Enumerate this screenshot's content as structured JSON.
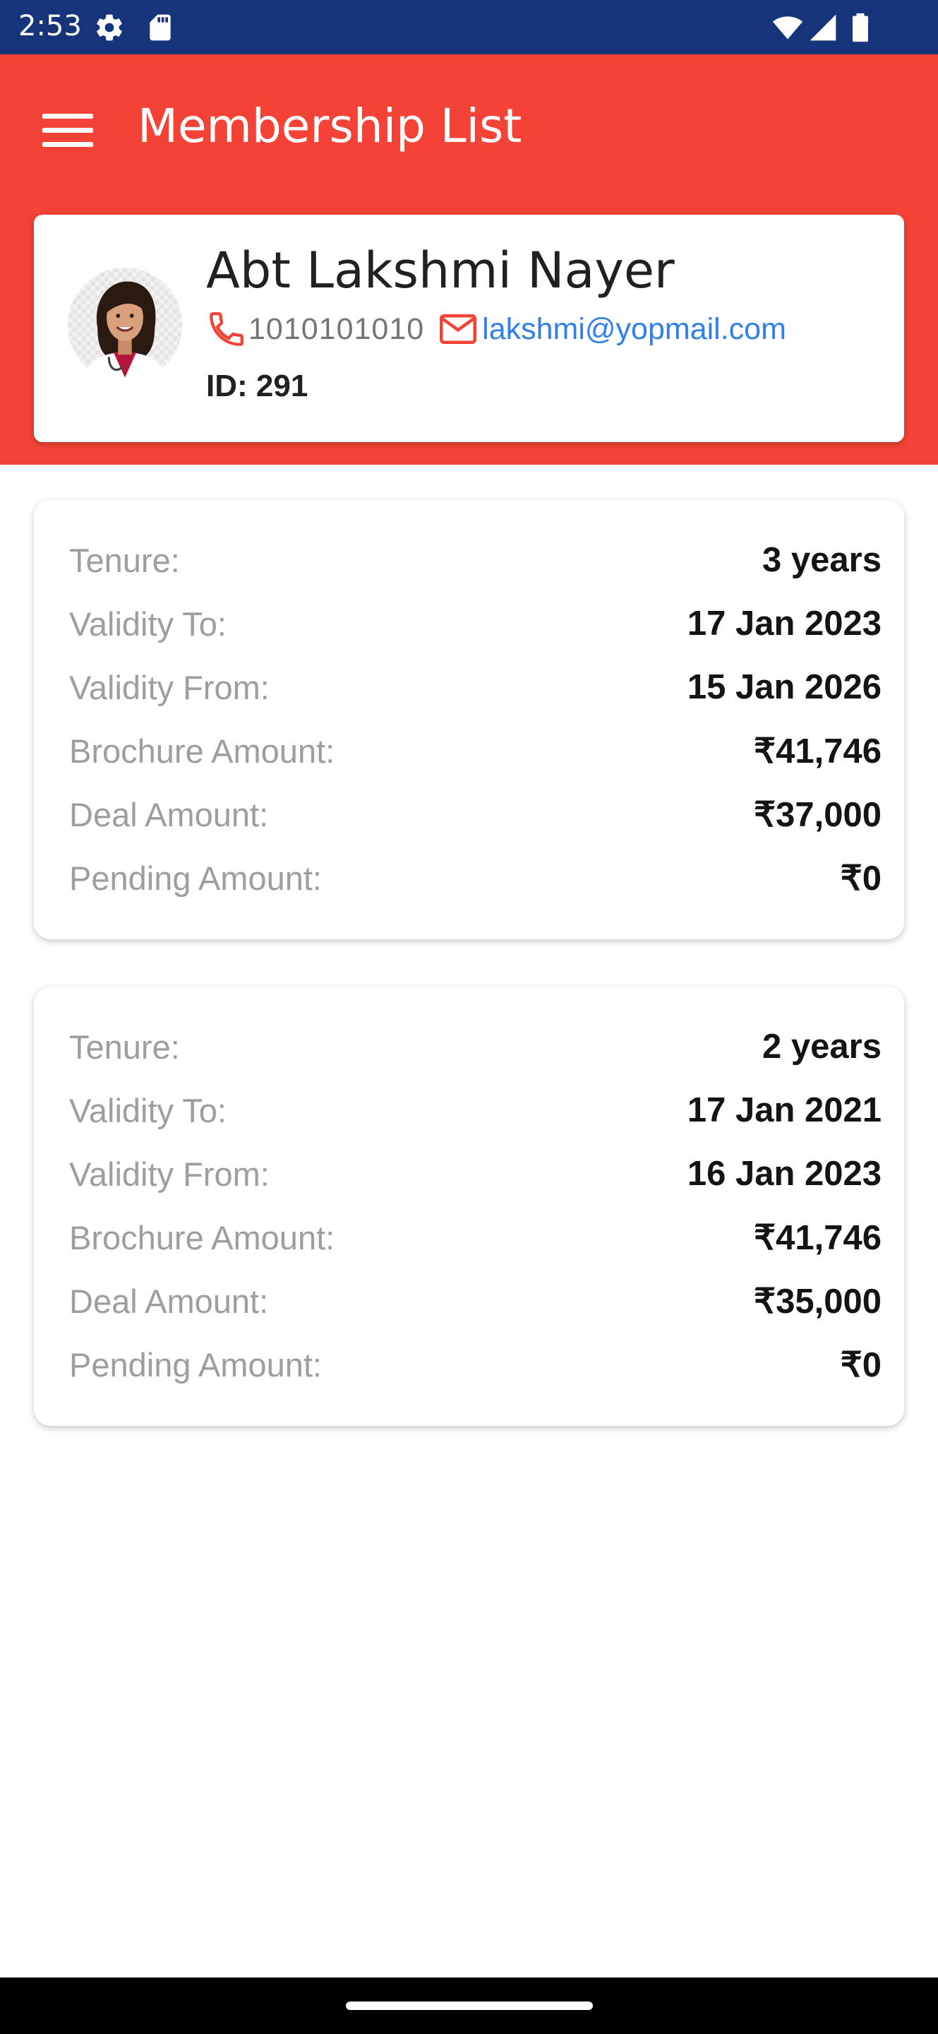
{
  "status_bar": {
    "time": "2:53",
    "icons": [
      "gear-icon",
      "sd-card-icon",
      "wifi-icon",
      "cell-signal-icon",
      "battery-icon"
    ]
  },
  "app_bar": {
    "title": "Membership List",
    "menu_icon": "hamburger-menu-icon",
    "color": "#f44336"
  },
  "profile": {
    "name": "Abt Lakshmi Nayer",
    "phone": "1010101010",
    "email": "lakshmi@yopmail.com",
    "id_label": "ID: 291",
    "accent_color": "#f44336",
    "link_color": "#2f80ed"
  },
  "memberships": [
    {
      "rows": [
        {
          "label": "Tenure:",
          "value": "3 years"
        },
        {
          "label": "Validity To:",
          "value": "17 Jan 2023"
        },
        {
          "label": "Validity From:",
          "value": "15 Jan 2026"
        },
        {
          "label": "Brochure Amount:",
          "value": "₹41,746"
        },
        {
          "label": "Deal Amount:",
          "value": "₹37,000"
        },
        {
          "label": "Pending Amount:",
          "value": "₹0"
        }
      ]
    },
    {
      "rows": [
        {
          "label": "Tenure:",
          "value": "2 years"
        },
        {
          "label": "Validity To:",
          "value": "17 Jan 2021"
        },
        {
          "label": "Validity From:",
          "value": "16 Jan 2023"
        },
        {
          "label": "Brochure Amount:",
          "value": "₹41,746"
        },
        {
          "label": "Deal Amount:",
          "value": "₹35,000"
        },
        {
          "label": "Pending Amount:",
          "value": "₹0"
        }
      ]
    }
  ]
}
